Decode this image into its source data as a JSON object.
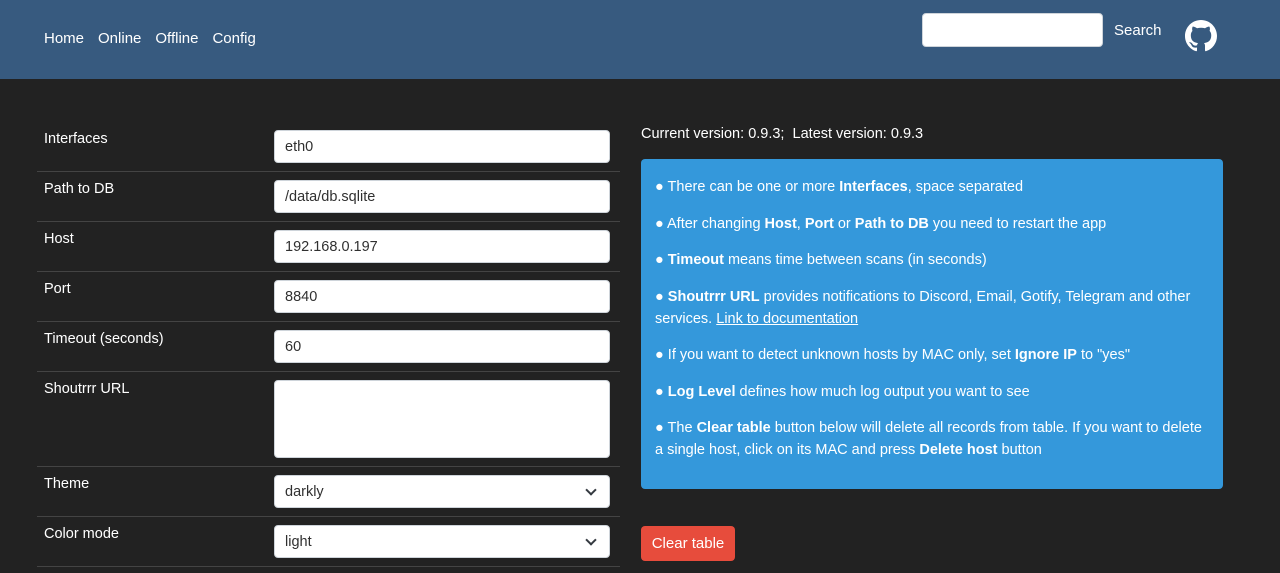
{
  "nav": {
    "links": [
      "Home",
      "Online",
      "Offline",
      "Config"
    ],
    "search_value": "",
    "search_label": "Search",
    "github_icon": "github-icon"
  },
  "form": {
    "interfaces": {
      "label": "Interfaces",
      "value": "eth0"
    },
    "db_path": {
      "label": "Path to DB",
      "value": "/data/db.sqlite"
    },
    "host": {
      "label": "Host",
      "value": "192.168.0.197"
    },
    "port": {
      "label": "Port",
      "value": "8840"
    },
    "timeout": {
      "label": "Timeout (seconds)",
      "value": "60"
    },
    "shoutrrr": {
      "label": "Shoutrrr URL",
      "value": ""
    },
    "theme": {
      "label": "Theme",
      "value": "darkly"
    },
    "color_mode": {
      "label": "Color mode",
      "value": "light"
    }
  },
  "version": {
    "current_label": "Current version:",
    "current": "0.9.3;",
    "latest_label": "Latest version:",
    "latest": "0.9.3"
  },
  "info": {
    "bullet": "●",
    "l1": {
      "a": "There can be one or more ",
      "b": "Interfaces",
      "c": ", space separated"
    },
    "l2": {
      "a": "After changing ",
      "b": "Host",
      "c": ", ",
      "d": "Port",
      "e": " or ",
      "f": "Path to DB",
      "g": " you need to restart the app"
    },
    "l3": {
      "b": "Timeout",
      "c": " means time between scans (in seconds)"
    },
    "l4": {
      "b": "Shoutrrr URL",
      "c": " provides notifications to Discord, Email, Gotify, Telegram and other services. ",
      "link": "Link to documentation"
    },
    "l5": {
      "a": "If you want to detect unknown hosts by MAC only, set ",
      "b": "Ignore IP",
      "c": " to \"yes\""
    },
    "l6": {
      "b": "Log Level",
      "c": " defines how much log output you want to see"
    },
    "l7": {
      "a": "The ",
      "b": "Clear table",
      "c": " button below will delete all records from table. If you want to delete a single host, click on its MAC and press ",
      "d": "Delete host",
      "e": " button"
    }
  },
  "clear_button": "Clear table",
  "colors": {
    "navbar": "#375a7f",
    "background": "#222222",
    "info": "#3498db",
    "danger": "#e74c3c"
  }
}
